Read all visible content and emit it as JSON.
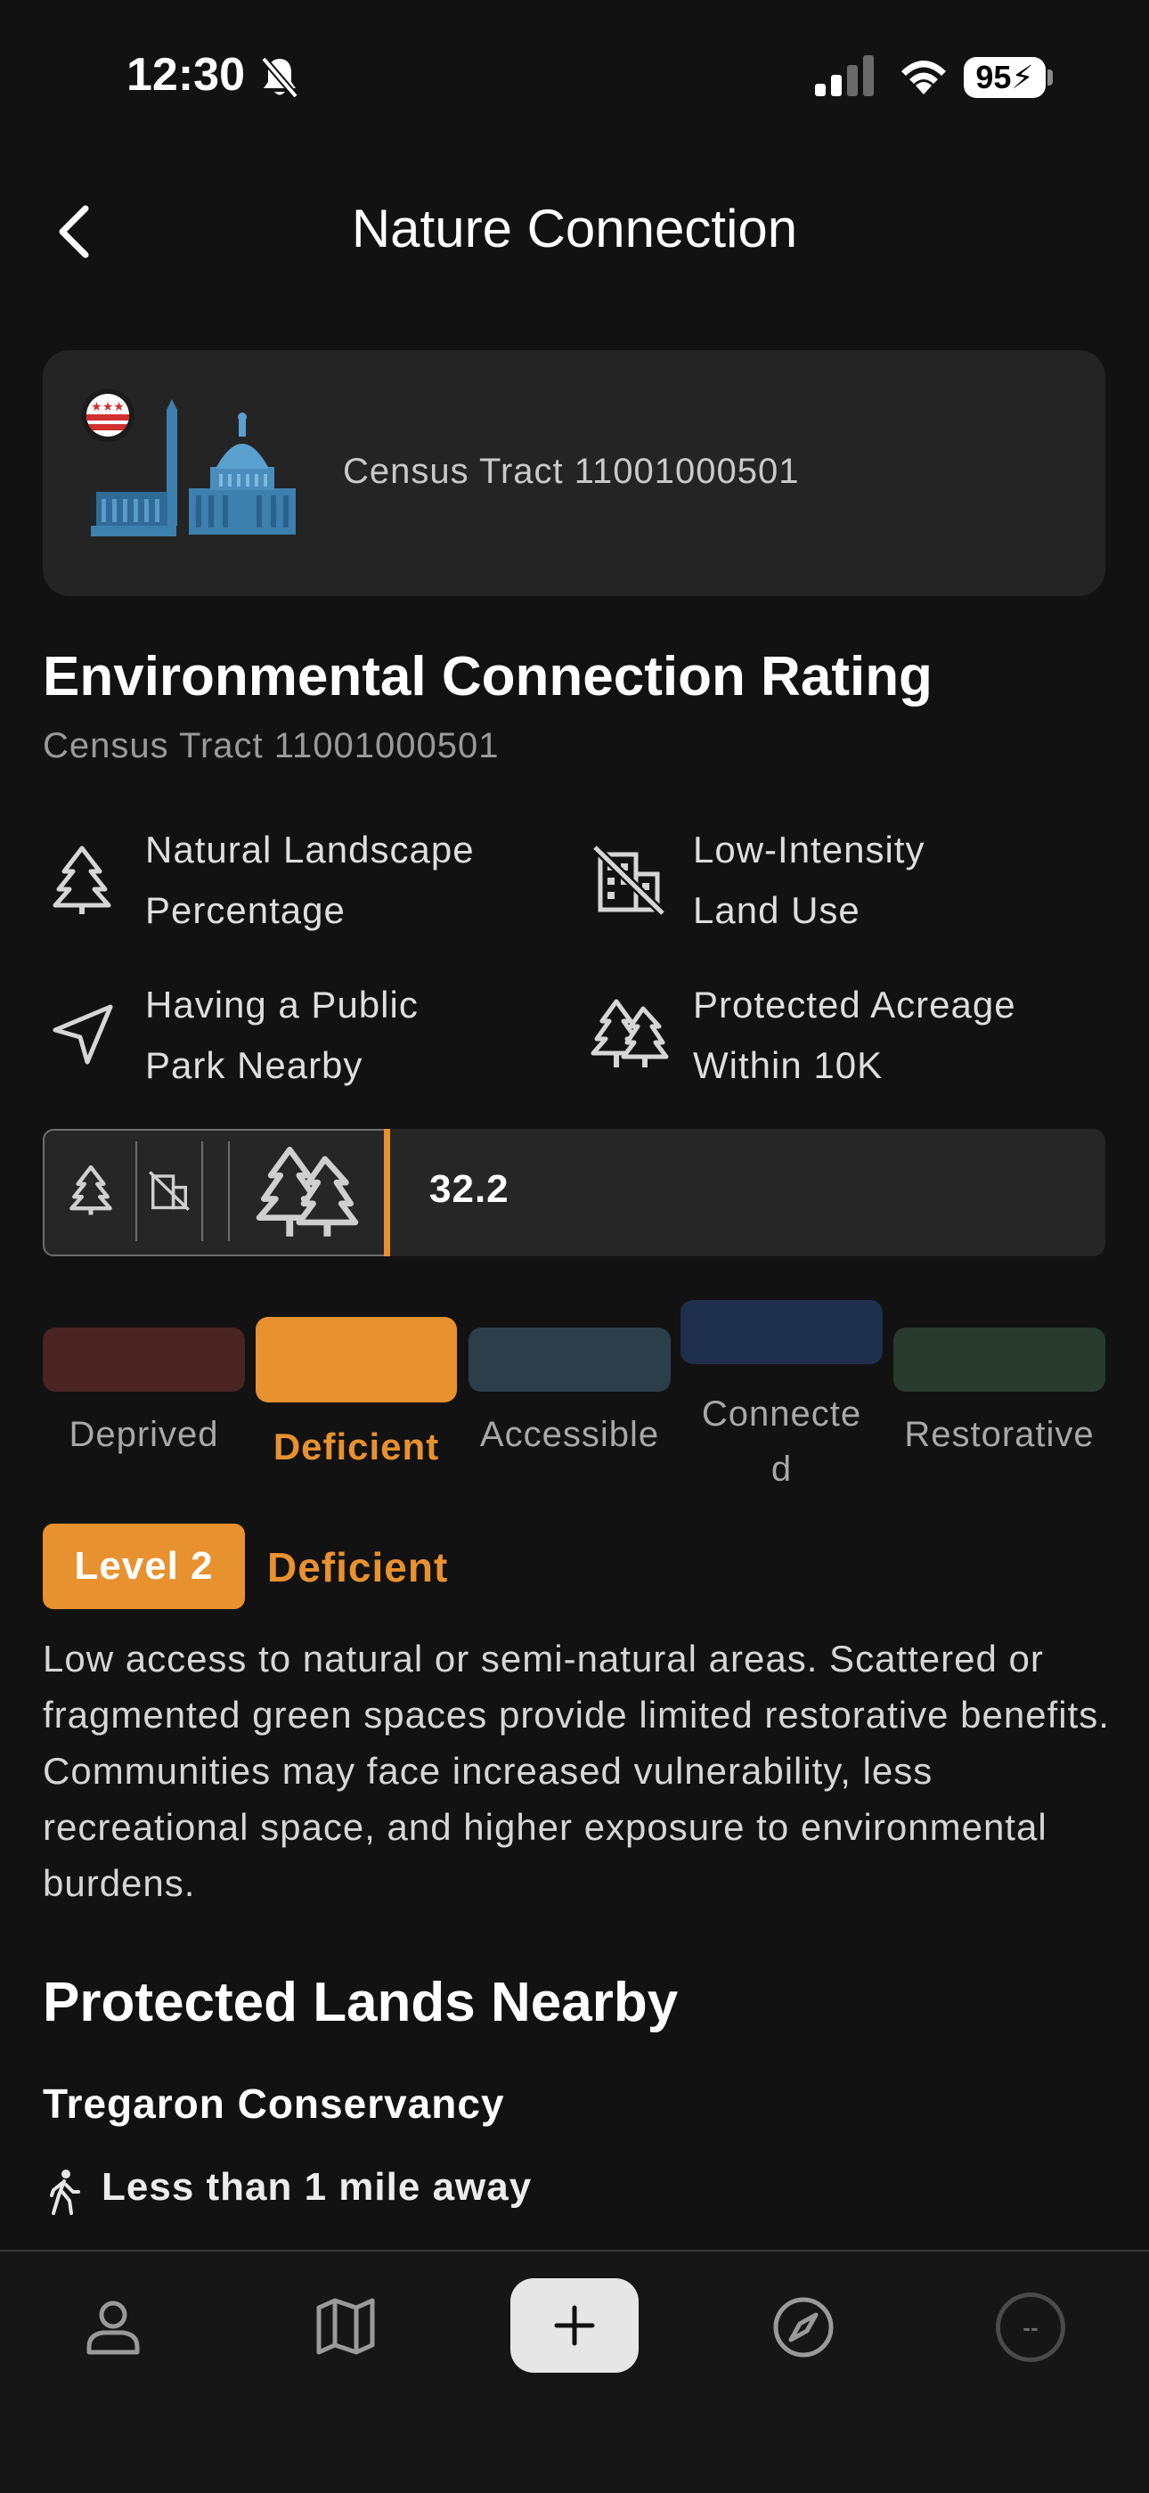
{
  "status_bar": {
    "time": "12:30",
    "battery": "95"
  },
  "nav": {
    "title": "Nature Connection"
  },
  "header_card": {
    "tract": "Census Tract 11001000501"
  },
  "rating": {
    "title": "Environmental Connection Rating",
    "subtitle": "Census Tract 11001000501",
    "factors": [
      {
        "line1": "Natural Landscape",
        "line2": "Percentage",
        "icon": "pine-tree-icon"
      },
      {
        "line1": "Low-Intensity",
        "line2": "Land Use",
        "icon": "building-off-icon"
      },
      {
        "line1": "Having a Public",
        "line2": "Park Nearby",
        "icon": "navigation-arrow-icon"
      },
      {
        "line1": "Protected Acreage",
        "line2": "Within 10K",
        "icon": "forest-trees-icon"
      }
    ],
    "score": "32.2"
  },
  "scale": {
    "levels": [
      {
        "label": "Deprived",
        "color": "#4a2422"
      },
      {
        "label": "Deficient",
        "color": "#e8912f"
      },
      {
        "label": "Accessible",
        "color": "#2c3e4a"
      },
      {
        "label_line1": "Connecte",
        "label_line2": "d",
        "color": "#1e2f4d"
      },
      {
        "label": "Restorative",
        "color": "#293a2e"
      }
    ],
    "selected_index": 1
  },
  "level": {
    "badge": "Level 2",
    "name": "Deficient",
    "description": "Low access to natural or semi-natural areas. Scattered or fragmented green spaces provide limited restorative benefits. Communities may face increased vulnerability, less recreational space, and higher exposure to environmental burdens."
  },
  "protected_lands": {
    "title": "Protected Lands Nearby",
    "items": [
      {
        "name": "Tregaron Conservancy",
        "distance": "Less than 1 mile away"
      }
    ]
  },
  "tab_bar": {
    "avatar_text": "--",
    "accent": "#e8912f"
  }
}
